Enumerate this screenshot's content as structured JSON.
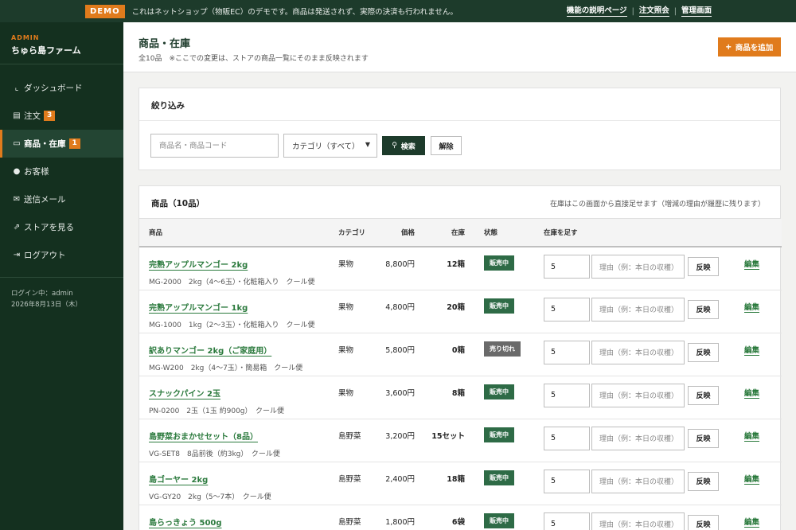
{
  "topbar": {
    "demo_badge": "DEMO",
    "demo_text": "これはネットショップ（物販EC）のデモです。商品は発送されず、実際の決済も行われません。",
    "links": [
      "機能の説明ページ",
      "注文照会",
      "管理画面"
    ]
  },
  "sidebar": {
    "brand_small": "ADMIN",
    "brand_name": "ちゅら島ファーム",
    "items": [
      {
        "label": "ダッシュボード",
        "icon": "chart-icon",
        "badge": ""
      },
      {
        "label": "注文",
        "icon": "document-icon",
        "badge": "3"
      },
      {
        "label": "商品・在庫",
        "icon": "boxes-icon",
        "badge": "1"
      },
      {
        "label": "お客様",
        "icon": "users-icon",
        "badge": ""
      },
      {
        "label": "送信メール",
        "icon": "mail-icon",
        "badge": ""
      },
      {
        "label": "ストアを見る",
        "icon": "external-link-icon",
        "badge": ""
      },
      {
        "label": "ログアウト",
        "icon": "logout-icon",
        "badge": ""
      }
    ],
    "login_user": "ログイン中：admin",
    "date": "2026年8月13日（木）"
  },
  "header": {
    "title": "商品・在庫",
    "subtitle": "全10品　※ここでの変更は、ストアの商品一覧にそのまま反映されます",
    "add_button": "商品を追加"
  },
  "filter": {
    "title": "絞り込み",
    "search_placeholder": "商品名・商品コード",
    "category_selected": "カテゴリ（すべて）",
    "search_button": "検索",
    "clear_button": "解除"
  },
  "products": {
    "title": "商品（10品）",
    "note": "在庫はこの画面から直接足せます（増減の理由が履歴に残ります）",
    "columns": {
      "product": "商品",
      "category": "カテゴリ",
      "price": "価格",
      "stock": "在庫",
      "status": "状態",
      "add_stock": "在庫を足す"
    },
    "qty_default": "5",
    "reason_placeholder": "理由（例：本日の収穫）",
    "apply_label": "反映",
    "edit_label": "編集",
    "rows": [
      {
        "name": "完熟アップルマンゴー 2kg",
        "meta": "MG-2000　2kg（4〜6玉）・化粧箱入り　クール便",
        "category": "果物",
        "price": "8,800円",
        "stock": "12箱",
        "status": "販売中",
        "available": true
      },
      {
        "name": "完熟アップルマンゴー 1kg",
        "meta": "MG-1000　1kg（2〜3玉）・化粧箱入り　クール便",
        "category": "果物",
        "price": "4,800円",
        "stock": "20箱",
        "status": "販売中",
        "available": true
      },
      {
        "name": "訳ありマンゴー 2kg（ご家庭用）",
        "meta": "MG-W200　2kg（4〜7玉）・簡易箱　クール便",
        "category": "果物",
        "price": "5,800円",
        "stock": "0箱",
        "status": "売り切れ",
        "available": false
      },
      {
        "name": "スナックパイン 2玉",
        "meta": "PN-0200　2玉（1玉 約900g）　クール便",
        "category": "果物",
        "price": "3,600円",
        "stock": "8箱",
        "status": "販売中",
        "available": true
      },
      {
        "name": "島野菜おまかせセット（8品）",
        "meta": "VG-SET8　8品前後（約3kg）　クール便",
        "category": "島野菜",
        "price": "3,200円",
        "stock": "15セット",
        "status": "販売中",
        "available": true
      },
      {
        "name": "島ゴーヤー 2kg",
        "meta": "VG-GY20　2kg（5〜7本）　クール便",
        "category": "島野菜",
        "price": "2,400円",
        "stock": "18箱",
        "status": "販売中",
        "available": true
      },
      {
        "name": "島らっきょう 500g",
        "meta": "",
        "category": "島野菜",
        "price": "1,800円",
        "stock": "6袋",
        "status": "販売中",
        "available": true
      }
    ]
  }
}
